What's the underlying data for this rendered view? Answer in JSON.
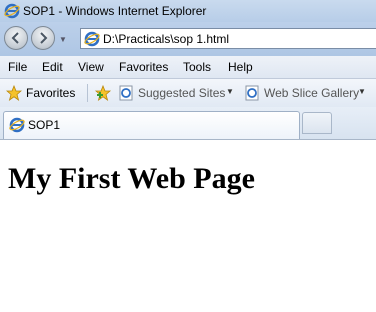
{
  "window": {
    "title": "SOP1 - Windows Internet Explorer"
  },
  "address_bar": {
    "url": "D:\\Practicals\\sop 1.html"
  },
  "menu": {
    "items": [
      {
        "label": "File"
      },
      {
        "label": "Edit"
      },
      {
        "label": "View"
      },
      {
        "label": "Favorites"
      },
      {
        "label": "Tools"
      },
      {
        "label": "Help"
      }
    ]
  },
  "favorites_bar": {
    "favorites_label": "Favorites",
    "suggested_sites_label": "Suggested Sites",
    "web_slice_gallery_label": "Web Slice Gallery"
  },
  "tabs": [
    {
      "label": "SOP1",
      "active": true
    }
  ],
  "page": {
    "heading": "My First Web Page"
  },
  "icons": {
    "browser": "ie-icon",
    "favorites": "star-icon",
    "add_favorite": "add-favorites-icon",
    "back": "back-arrow-icon",
    "forward": "forward-arrow-icon"
  },
  "colors": {
    "ie_blue": "#2f6fc4",
    "star_yellow": "#f5c22b",
    "chrome_blue": "#bcd0ea"
  }
}
